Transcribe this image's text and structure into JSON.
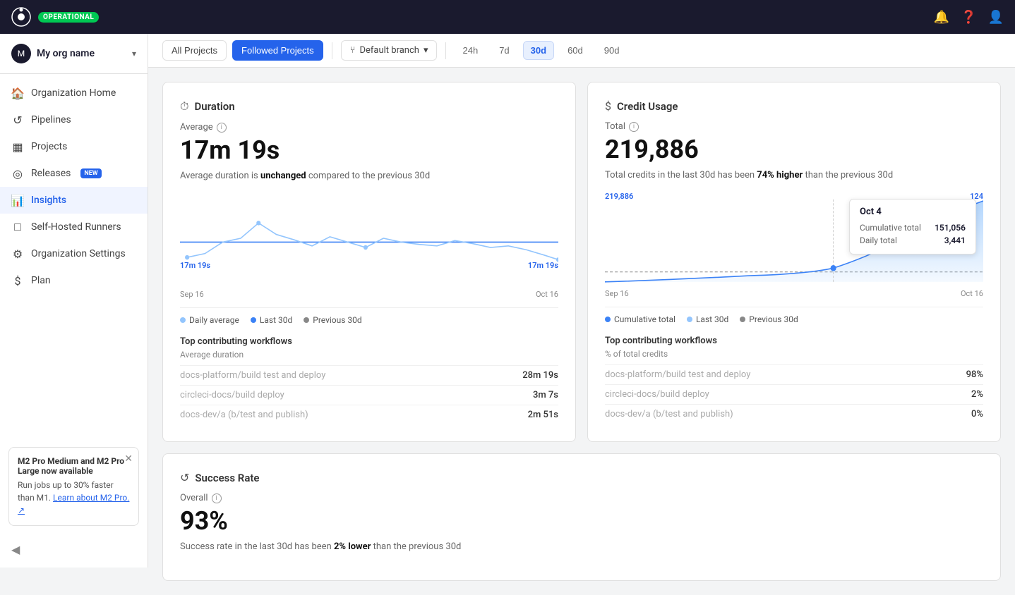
{
  "topnav": {
    "logo_text": "circleci",
    "status_badge": "OPERATIONAL",
    "icons": [
      "bell",
      "question",
      "user"
    ]
  },
  "org": {
    "name": "My org name",
    "avatar_text": "M"
  },
  "sidebar": {
    "items": [
      {
        "id": "org-home",
        "label": "Organization Home",
        "icon": "🏠",
        "active": false
      },
      {
        "id": "pipelines",
        "label": "Pipelines",
        "icon": "⟳",
        "active": false
      },
      {
        "id": "projects",
        "label": "Projects",
        "icon": "▦",
        "active": false
      },
      {
        "id": "releases",
        "label": "Releases",
        "icon": "◎",
        "active": false,
        "badge": "NEW"
      },
      {
        "id": "insights",
        "label": "Insights",
        "icon": "📊",
        "active": true
      },
      {
        "id": "self-hosted-runners",
        "label": "Self-Hosted Runners",
        "icon": "□",
        "active": false
      },
      {
        "id": "org-settings",
        "label": "Organization Settings",
        "icon": "⚙",
        "active": false
      },
      {
        "id": "plan",
        "label": "Plan",
        "icon": "$",
        "active": false
      }
    ]
  },
  "promo": {
    "title": "M2 Pro Medium and M2 Pro Large now available",
    "text": "Run jobs up to 30% faster than M1.",
    "link_text": "Learn about M2 Pro.",
    "link_symbol": "↗"
  },
  "toolbar": {
    "all_projects_label": "All Projects",
    "followed_projects_label": "Followed Projects",
    "branch_label": "Default branch",
    "time_options": [
      "24h",
      "7d",
      "30d",
      "60d",
      "90d"
    ],
    "active_time": "30d"
  },
  "duration_card": {
    "title": "Duration",
    "metric_label": "Average",
    "metric_value": "17m 19s",
    "description_prefix": "Average duration is ",
    "description_keyword": "unchanged",
    "description_suffix": " compared to the previous 30d",
    "chart_start": "Sep 16",
    "chart_end": "Oct 16",
    "label_left": "17m 19s",
    "label_right": "17m 19s",
    "legend": [
      {
        "label": "Daily average",
        "color": "#93c5fd"
      },
      {
        "label": "Last 30d",
        "color": "#3b82f6"
      },
      {
        "label": "Previous 30d",
        "color": "#888"
      }
    ],
    "workflows_title": "Top contributing workflows",
    "workflows_sub": "Average duration",
    "workflows": [
      {
        "name": "docs-platform/build test and deploy",
        "value": "28m 19s",
        "pct": 95
      },
      {
        "name": "circleci-docs/build deploy",
        "value": "3m 7s",
        "pct": 30
      },
      {
        "name": "docs-dev/a (b/test and publish)",
        "value": "2m 51s",
        "pct": 25
      }
    ]
  },
  "credit_card": {
    "title": "Credit Usage",
    "metric_label": "Total",
    "metric_value": "219,886",
    "description_prefix": "Total credits in the last 30d has been ",
    "description_keyword": "74% higher",
    "description_suffix": " than the previous 30d",
    "chart_start": "Sep 16",
    "chart_end": "Oct 16",
    "label_left": "219,886",
    "label_right": "124",
    "tooltip": {
      "date": "Oct 4",
      "cumulative_label": "Cumulative total",
      "cumulative_value": "151,056",
      "daily_label": "Daily total",
      "daily_value": "3,441"
    },
    "legend": [
      {
        "label": "Cumulative total",
        "color": "#3b82f6"
      },
      {
        "label": "Last 30d",
        "color": "#93c5fd"
      },
      {
        "label": "Previous 30d",
        "color": "#888"
      }
    ],
    "workflows_title": "Top contributing workflows",
    "workflows_sub": "% of total credits",
    "workflows": [
      {
        "name": "docs-platform/build test and deploy",
        "value": "98%",
        "pct": 98
      },
      {
        "name": "circleci-docs/build deploy",
        "value": "2%",
        "pct": 2
      },
      {
        "name": "docs-dev/a (b/test and publish)",
        "value": "0%",
        "pct": 0
      }
    ]
  },
  "success_card": {
    "title": "Success Rate",
    "metric_label": "Overall",
    "metric_value": "93%",
    "description_prefix": "Success rate in the last 30d has been ",
    "description_keyword": "2% lower",
    "description_suffix": " than the previous 30d"
  }
}
